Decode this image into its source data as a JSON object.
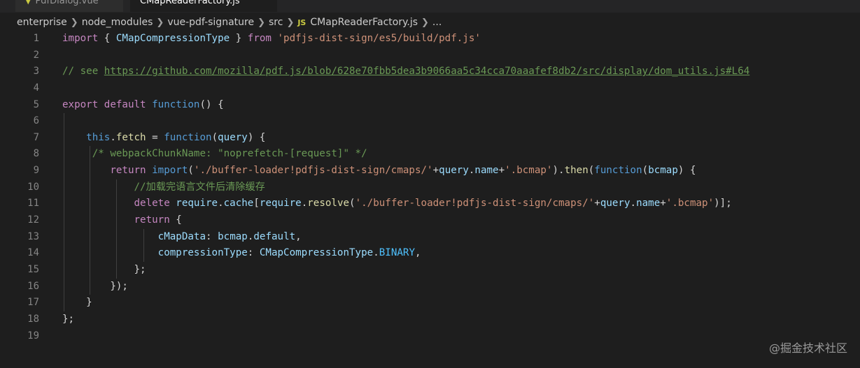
{
  "tabs": [
    {
      "label": "PdfDialog.vue",
      "active": false,
      "icon": "vue-icon"
    },
    {
      "label": "CMapReaderFactory.js",
      "active": true,
      "icon": "js-icon"
    }
  ],
  "breadcrumb": {
    "items": [
      "enterprise",
      "node_modules",
      "vue-pdf-signature",
      "src",
      "CMapReaderFactory.js",
      "..."
    ],
    "file_badge": "JS"
  },
  "editor": {
    "line_numbers": [
      "1",
      "2",
      "3",
      "4",
      "5",
      "6",
      "7",
      "8",
      "9",
      "10",
      "11",
      "12",
      "13",
      "14",
      "15",
      "16",
      "17",
      "18",
      "19"
    ],
    "lines": [
      {
        "n": 1,
        "tokens": [
          [
            "kw",
            "import"
          ],
          [
            "pn",
            " { "
          ],
          [
            "vr",
            "CMapCompressionType"
          ],
          [
            "pn",
            " } "
          ],
          [
            "kw",
            "from"
          ],
          [
            "pn",
            " "
          ],
          [
            "st",
            "'pdfjs-dist-sign/es5/build/pdf.js'"
          ]
        ]
      },
      {
        "n": 2,
        "tokens": []
      },
      {
        "n": 3,
        "tokens": [
          [
            "cm",
            "// see "
          ],
          [
            "lnk",
            "https://github.com/mozilla/pdf.js/blob/628e70fbb5dea3b9066aa5c34cca70aaafef8db2/src/display/dom_utils.js#L64"
          ]
        ]
      },
      {
        "n": 4,
        "tokens": []
      },
      {
        "n": 5,
        "tokens": [
          [
            "kw",
            "export"
          ],
          [
            "pn",
            " "
          ],
          [
            "kw",
            "default"
          ],
          [
            "pn",
            " "
          ],
          [
            "kwb",
            "function"
          ],
          [
            "pn",
            "() {"
          ]
        ]
      },
      {
        "n": 6,
        "tokens": []
      },
      {
        "n": 7,
        "tokens": [
          [
            "pn",
            "    "
          ],
          [
            "kwb",
            "this"
          ],
          [
            "pn",
            "."
          ],
          [
            "fn",
            "fetch"
          ],
          [
            "pn",
            " = "
          ],
          [
            "kwb",
            "function"
          ],
          [
            "pn",
            "("
          ],
          [
            "vr",
            "query"
          ],
          [
            "pn",
            ") {"
          ]
        ]
      },
      {
        "n": 8,
        "tokens": [
          [
            "pn",
            "     "
          ],
          [
            "cm",
            "/* webpackChunkName: \"noprefetch-[request]\" */"
          ]
        ]
      },
      {
        "n": 9,
        "tokens": [
          [
            "pn",
            "        "
          ],
          [
            "kw",
            "return"
          ],
          [
            "pn",
            " "
          ],
          [
            "kwb",
            "import"
          ],
          [
            "pn",
            "("
          ],
          [
            "st",
            "'./buffer-loader!pdfjs-dist-sign/cmaps/'"
          ],
          [
            "pn",
            "+"
          ],
          [
            "vr",
            "query"
          ],
          [
            "pn",
            "."
          ],
          [
            "vr",
            "name"
          ],
          [
            "pn",
            "+"
          ],
          [
            "st",
            "'.bcmap'"
          ],
          [
            "pn",
            ")."
          ],
          [
            "fn",
            "then"
          ],
          [
            "pn",
            "("
          ],
          [
            "kwb",
            "function"
          ],
          [
            "pn",
            "("
          ],
          [
            "vr",
            "bcmap"
          ],
          [
            "pn",
            ") {"
          ]
        ]
      },
      {
        "n": 10,
        "tokens": [
          [
            "pn",
            "            "
          ],
          [
            "cm",
            "//加载完语言文件后清除缓存"
          ]
        ]
      },
      {
        "n": 11,
        "tokens": [
          [
            "pn",
            "            "
          ],
          [
            "kw",
            "delete"
          ],
          [
            "pn",
            " "
          ],
          [
            "vr",
            "require"
          ],
          [
            "pn",
            "."
          ],
          [
            "vr",
            "cache"
          ],
          [
            "pn",
            "["
          ],
          [
            "vr",
            "require"
          ],
          [
            "pn",
            "."
          ],
          [
            "fn",
            "resolve"
          ],
          [
            "pn",
            "("
          ],
          [
            "st",
            "'./buffer-loader!pdfjs-dist-sign/cmaps/'"
          ],
          [
            "pn",
            "+"
          ],
          [
            "vr",
            "query"
          ],
          [
            "pn",
            "."
          ],
          [
            "vr",
            "name"
          ],
          [
            "pn",
            "+"
          ],
          [
            "st",
            "'.bcmap'"
          ],
          [
            "pn",
            ")];"
          ]
        ]
      },
      {
        "n": 12,
        "tokens": [
          [
            "pn",
            "            "
          ],
          [
            "kw",
            "return"
          ],
          [
            "pn",
            " {"
          ]
        ]
      },
      {
        "n": 13,
        "tokens": [
          [
            "pn",
            "                "
          ],
          [
            "vr",
            "cMapData"
          ],
          [
            "pn",
            ": "
          ],
          [
            "vr",
            "bcmap"
          ],
          [
            "pn",
            "."
          ],
          [
            "vr",
            "default"
          ],
          [
            "pn",
            ","
          ]
        ]
      },
      {
        "n": 14,
        "tokens": [
          [
            "pn",
            "                "
          ],
          [
            "vr",
            "compressionType"
          ],
          [
            "pn",
            ": "
          ],
          [
            "vr",
            "CMapCompressionType"
          ],
          [
            "pn",
            "."
          ],
          [
            "cn",
            "BINARY"
          ],
          [
            "pn",
            ","
          ]
        ]
      },
      {
        "n": 15,
        "tokens": [
          [
            "pn",
            "            };"
          ]
        ]
      },
      {
        "n": 16,
        "tokens": [
          [
            "pn",
            "        });"
          ]
        ]
      },
      {
        "n": 17,
        "tokens": [
          [
            "pn",
            "    }"
          ]
        ]
      },
      {
        "n": 18,
        "tokens": [
          [
            "pn",
            "};"
          ]
        ]
      },
      {
        "n": 19,
        "tokens": []
      }
    ]
  },
  "watermark": "@掘金技术社区",
  "colors": {
    "background": "#1e1e1e",
    "keyword": "#c586c0",
    "keyword_blue": "#569cd6",
    "function": "#dcdcaa",
    "variable": "#9cdcfe",
    "string": "#ce9178",
    "comment": "#6a9955",
    "constant": "#4fc1ff"
  }
}
